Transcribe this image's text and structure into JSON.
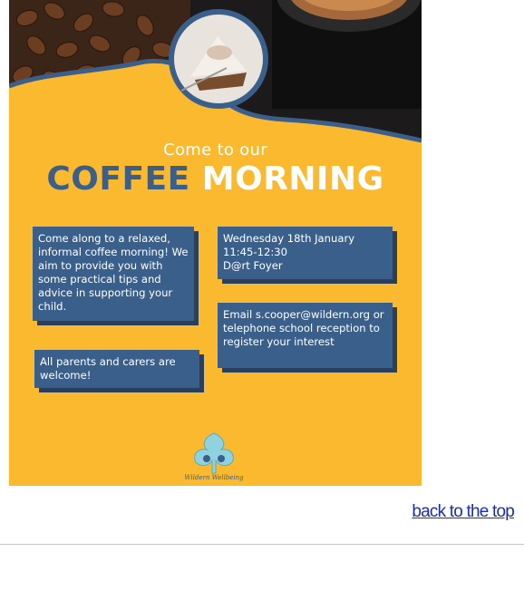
{
  "poster": {
    "intro": "Come to our",
    "headline_word1": "COFFEE",
    "headline_word2": "MORNING",
    "box_intro": "Come along to a relaxed, informal coffee morning! We aim to provide you with some practical tips and advice in supporting your child.",
    "box_date_line1": "Wednesday 18th January",
    "box_date_line2": "11:45-12:30",
    "box_date_line3": "D@rt Foyer",
    "box_email": "Email s.cooper@wildern.org or telephone school reception to register your interest",
    "box_parents": "All parents and carers are welcome!",
    "logo_text": "Wildern Wellbeing",
    "colors": {
      "background": "#fbb930",
      "navy": "#3b5f8b",
      "white": "#ffffff"
    }
  },
  "nav": {
    "back_to_top": "back to the top"
  }
}
